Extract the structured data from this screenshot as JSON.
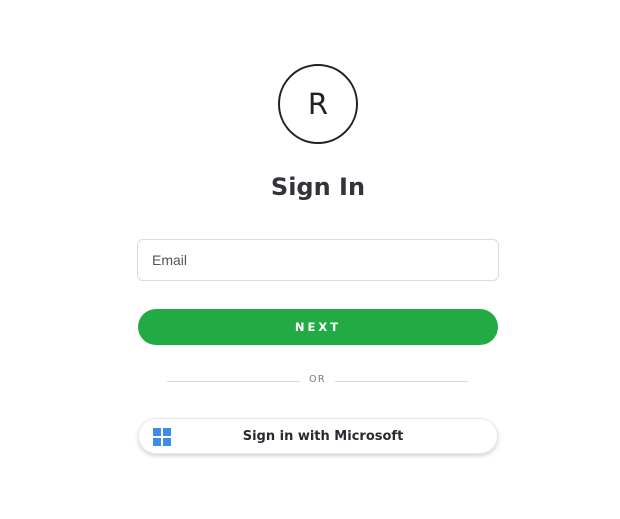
{
  "logo": {
    "letter": "R"
  },
  "page_title": "Sign In",
  "email_field": {
    "placeholder": "Email",
    "value": ""
  },
  "next_button": {
    "label": "NEXT",
    "color": "#22ab45"
  },
  "divider": {
    "label": "OR"
  },
  "microsoft_button": {
    "label": "Sign in with Microsoft",
    "icon": "windows-logo-icon",
    "icon_color": "#3f8be8"
  }
}
